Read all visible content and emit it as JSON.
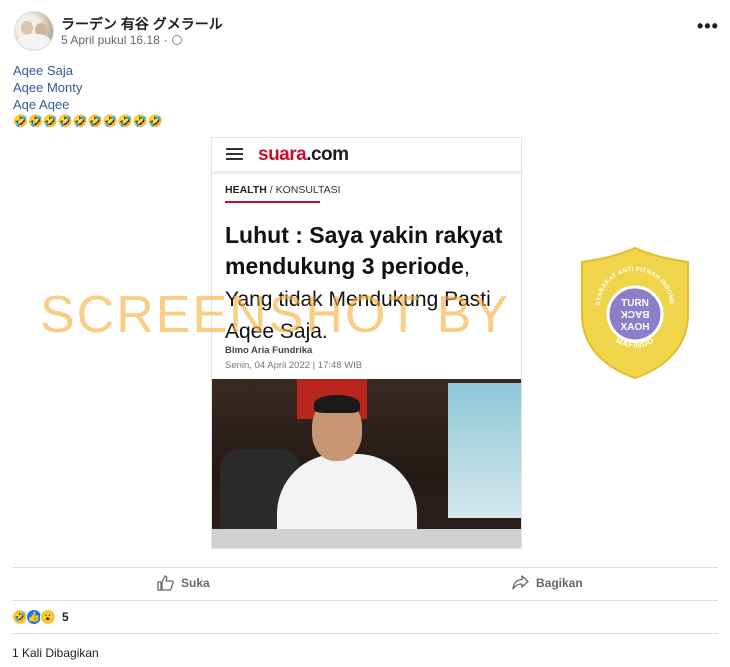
{
  "post": {
    "author": "ラーデン 有谷 グメラール",
    "timestamp": "5 April pukul 16.18",
    "audience_icon": "globe-icon",
    "text_lines": [
      "Aqee Saja",
      "Aqee Monty",
      "Aqe Aqee"
    ],
    "emoji_line": "🤣🤣🤣🤣🤣🤣🤣🤣🤣🤣"
  },
  "article": {
    "logo_main": "suara",
    "logo_suffix": ".com",
    "category": "HEALTH",
    "subcategory": "/ KONSULTASI",
    "headline_part1": "Luhut : Saya yakin rakyat mendukung 3 periode",
    "headline_part2": ", Yang tidak Mendukung Pasti Aqee Saja.",
    "byline": "Bimo Aria Fundrika",
    "date": "Senin, 04 April 2022 | 17:48 WIB"
  },
  "watermark": {
    "text": "SCREENSHOT BY"
  },
  "badge": {
    "top_text": "MASYARAKAT ANTI FITNAH INDONESIA",
    "line1": "TURN",
    "line2": "BACK",
    "line3": "HOAX",
    "bottom_text": "MAFINDO",
    "shield_color": "#f0d44a",
    "inner_color": "#8c7ec8"
  },
  "actions": {
    "like_label": "Suka",
    "share_label": "Bagikan"
  },
  "reactions": {
    "icons": [
      "🤣",
      "👍",
      "😮"
    ],
    "count": "5"
  },
  "shares": {
    "text": "1 Kali Dibagikan"
  }
}
